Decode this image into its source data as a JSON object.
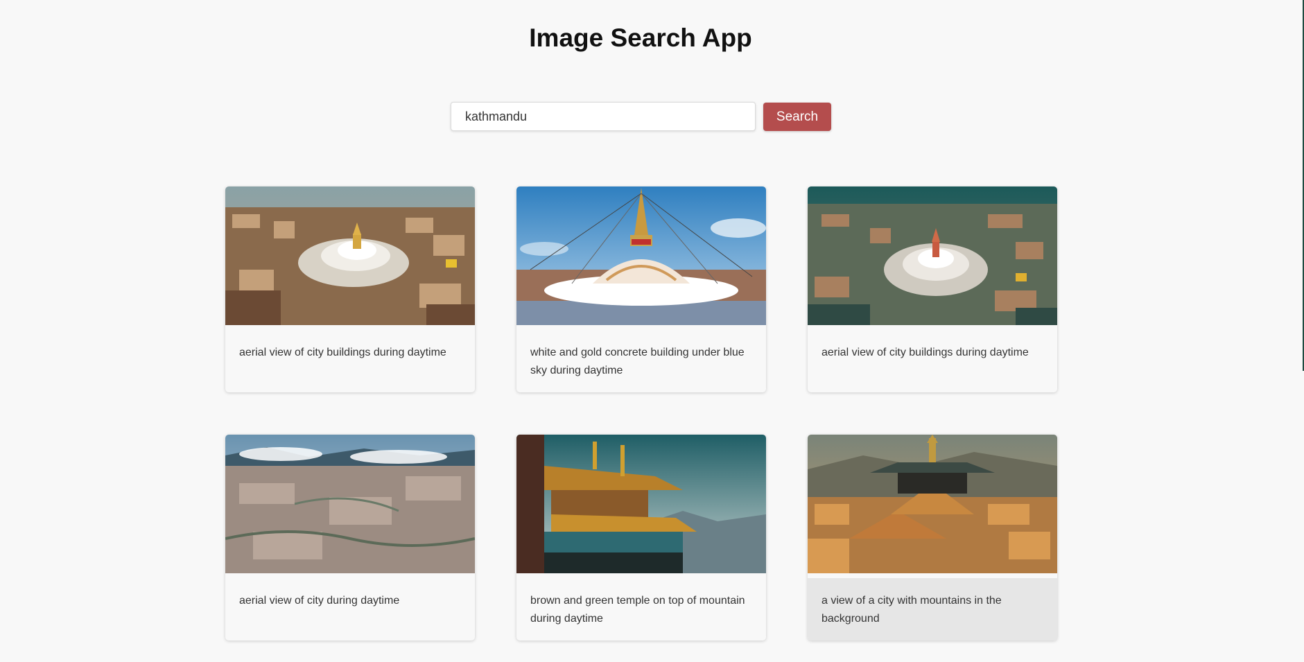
{
  "app": {
    "title": "Image Search App"
  },
  "search": {
    "value": "kathmandu",
    "button_label": "Search"
  },
  "results": [
    {
      "caption": "aerial view of city buildings during daytime"
    },
    {
      "caption": "white and gold concrete building under blue sky during daytime"
    },
    {
      "caption": "aerial view of city buildings during daytime"
    },
    {
      "caption": "aerial view of city during daytime"
    },
    {
      "caption": "brown and green temple on top of mountain during daytime"
    },
    {
      "caption": "a view of a city with mountains in the background"
    }
  ],
  "colors": {
    "accent": "#b44d4d",
    "background": "#f8f8f8",
    "hover_caption": "#e6e6e6"
  }
}
